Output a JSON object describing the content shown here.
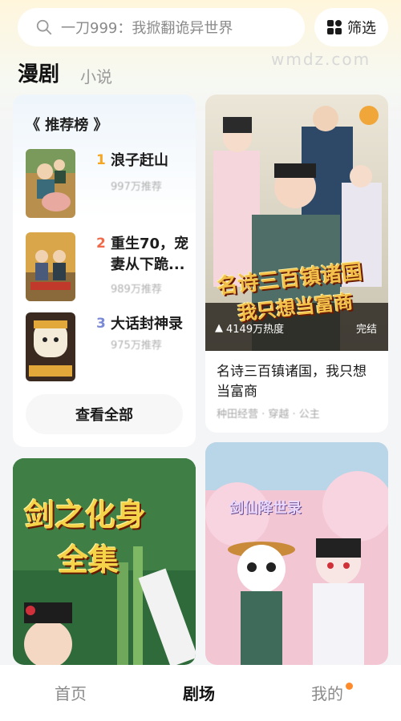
{
  "search": {
    "placeholder_text": "一刀999：我掀翻诡异世界",
    "filter_label": "筛选"
  },
  "watermark": "wmdz.com",
  "tabs": {
    "active": "漫剧",
    "inactive": "小说"
  },
  "ranking": {
    "title": "《 推荐榜 》",
    "items": [
      {
        "rank": "1",
        "name": "浪子赶山",
        "meta": "997万推荐",
        "rank_color": "#f5a623"
      },
      {
        "rank": "2",
        "name": "重生70，宠妻从下跪...",
        "meta": "989万推荐",
        "rank_color": "#f06a4a"
      },
      {
        "rank": "3",
        "name": "大话封神录",
        "meta": "975万推荐",
        "rank_color": "#7a8ad6"
      }
    ],
    "view_all": "查看全部"
  },
  "dramas": [
    {
      "title": "名诗三百镇诸国，我只想当富商",
      "tags": "种田经营 · 穿越 · 公主",
      "heat": "4149万热度",
      "status": "完结",
      "poster_text_1": "名诗三百镇诸国",
      "poster_text_2": "我只想当富商"
    },
    {
      "poster_text_1": "剑之化身",
      "poster_text_2": "全集"
    },
    {
      "poster_text_1": "剑仙降世录"
    }
  ],
  "nav": {
    "home": "首页",
    "theater": "剧场",
    "mine": "我的"
  },
  "colors": {
    "accent_orange": "#ff8a2a",
    "rank1": "#f5a623",
    "rank2": "#f06a4a",
    "rank3": "#7a8ad6"
  }
}
